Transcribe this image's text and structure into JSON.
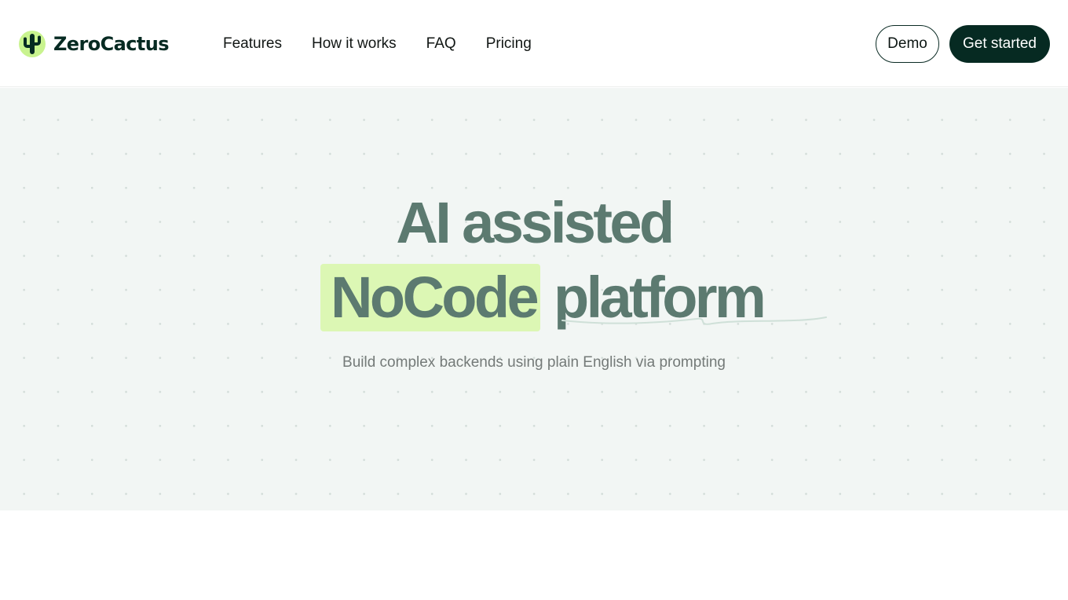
{
  "brand": {
    "name": "ZeroCactus",
    "logo_icon": "cactus-icon",
    "accent_color": "#c9f38f",
    "dark_color": "#062a22"
  },
  "nav": {
    "links": [
      {
        "label": "Features"
      },
      {
        "label": "How it works"
      },
      {
        "label": "FAQ"
      },
      {
        "label": "Pricing"
      }
    ]
  },
  "actions": {
    "demo_label": "Demo",
    "start_label": "Get started"
  },
  "hero": {
    "headline_line1": "AI assisted",
    "headline_highlight": "NoCode",
    "headline_rest": "platform",
    "subtitle": "Build complex backends using plain English via prompting",
    "text_color": "#5c7a70",
    "highlight_color": "#dcf7b4"
  }
}
